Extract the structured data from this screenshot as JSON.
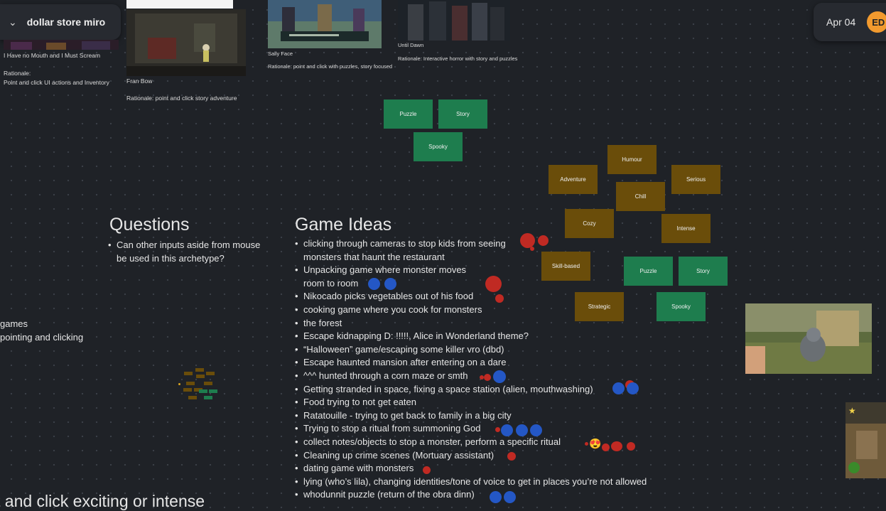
{
  "board": {
    "name": "dollar store miro",
    "date": "Apr 04",
    "avatar_initials": "ED"
  },
  "references": [
    {
      "title": "I Have no Mouth and I Must Scream",
      "rationale_label": "Rationale:",
      "rationale": "Point and click UI actions and Inventory"
    },
    {
      "title": "Fran Bow",
      "rationale": "Rationale: point and click story adventure"
    },
    {
      "title": "Sally Face",
      "rationale": "Rationale: point and click with puzzles, story focused"
    },
    {
      "title": "Until Dawn",
      "rationale": "Rationale: Interactive horror with story and puzzles"
    }
  ],
  "tags_top": [
    "Puzzle",
    "Story",
    "Spooky"
  ],
  "tags_cluster": {
    "olive": [
      "Humour",
      "Adventure",
      "Serious",
      "Chill",
      "Cozy",
      "Intense",
      "Skill-based",
      "Strategic"
    ],
    "green": [
      "Puzzle",
      "Story",
      "Spooky"
    ]
  },
  "questions": {
    "heading": "Questions",
    "items": [
      "Can other inputs aside from mouse be used in this archetype?"
    ]
  },
  "game_ideas": {
    "heading": "Game Ideas",
    "items": [
      "clicking through cameras to stop kids from seeing monsters that haunt the restaurant",
      "Unpacking game where monster moves room to room",
      "Nikocado picks vegetables out of his food",
      "cooking game where you cook for monsters",
      "the forest",
      "Escape kidnapping D: !!!!!, Alice in Wonderland theme?",
      "“Halloween” game/escaping some killer vro (dbd)",
      "Escape haunted mansion after entering on a dare",
      "^^^ hunted through a corn maze or smth",
      "Getting stranded in space, fixing a space station (alien, mouthwashing)",
      "Food trying to not get eaten",
      "Ratatouille - trying to get back to family in a big city",
      "Trying to stop a ritual from summoning God",
      "collect notes/objects to stop a monster, perform a specific ritual",
      "Cleaning up crime scenes (Mortuary assistant)",
      "dating game with monsters",
      "lying (who’s lila), changing identities/tone of voice to get in places you’re not allowed",
      "whodunnit puzzle (return of the obra dinn)"
    ]
  },
  "left_fragments": [
    "games",
    "pointing and clicking"
  ],
  "bottom_fragment": "t and click exciting or intense",
  "reaction_emoji": "😍",
  "colors": {
    "board_bg": "#1f2227",
    "sticky_green": "#1e7d4e",
    "sticky_olive": "#6a4d0a",
    "vote_red": "#c02a23",
    "vote_blue": "#2457c5",
    "avatar": "#f29a2e"
  }
}
